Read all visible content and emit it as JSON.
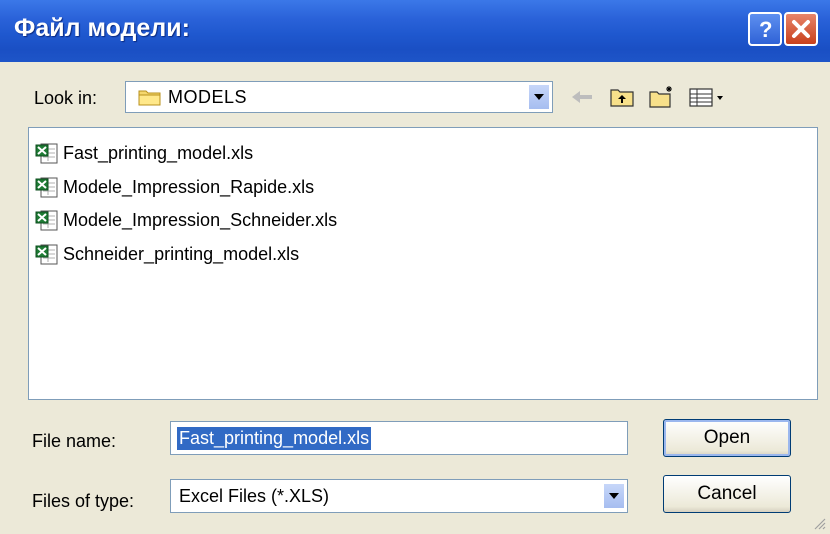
{
  "window": {
    "title": "Файл модели:"
  },
  "titlebar_buttons": {
    "help": "?",
    "close_icon": "close-icon"
  },
  "look_in": {
    "label": "Look in:",
    "value": "MODELS",
    "icon": "folder-icon"
  },
  "toolbar": {
    "icons": [
      "back-arrow-icon",
      "up-folder-icon",
      "new-folder-icon",
      "view-menu-icon"
    ]
  },
  "files": [
    {
      "name": "Fast_printing_model.xls",
      "icon": "excel-file-icon"
    },
    {
      "name": "Modele_Impression_Rapide.xls",
      "icon": "excel-file-icon"
    },
    {
      "name": "Modele_Impression_Schneider.xls",
      "icon": "excel-file-icon"
    },
    {
      "name": "Schneider_printing_model.xls",
      "icon": "excel-file-icon"
    }
  ],
  "file_name": {
    "label": "File name:",
    "value": "Fast_printing_model.xls"
  },
  "file_type": {
    "label": "Files of type:",
    "value": "Excel Files (*.XLS)"
  },
  "buttons": {
    "open": "Open",
    "cancel": "Cancel"
  },
  "colors": {
    "titlebar": "#2a62d9",
    "selection": "#316ac5",
    "dialog_bg": "#ece9d8"
  }
}
